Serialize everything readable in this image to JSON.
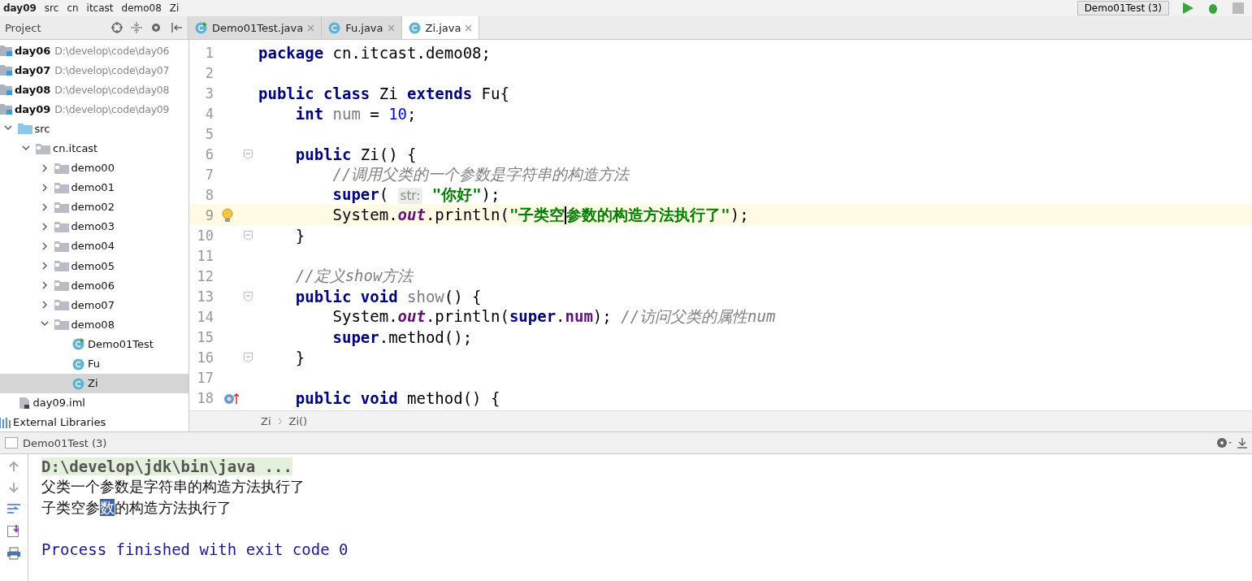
{
  "nav_bar": {
    "crumbs": [
      "day09",
      "src",
      "cn",
      "itcast",
      "demo08",
      "Zi"
    ]
  },
  "toolbar": {
    "run_config": "Demo01Test (3)"
  },
  "project_panel": {
    "title": "Project",
    "tree": [
      {
        "kind": "module",
        "label": "day06",
        "path": "D:\\develop\\code\\day06",
        "selected": false
      },
      {
        "kind": "module",
        "label": "day07",
        "path": "D:\\develop\\code\\day07",
        "selected": false
      },
      {
        "kind": "module",
        "label": "day08",
        "path": "D:\\develop\\code\\day08",
        "selected": false
      },
      {
        "kind": "module",
        "label": "day09",
        "path": "D:\\develop\\code\\day09",
        "selected": false,
        "children": [
          {
            "kind": "source",
            "label": "src",
            "expanded": true,
            "selected": false,
            "children": [
              {
                "kind": "package",
                "label": "cn.itcast",
                "expanded": true,
                "selected": false,
                "children": [
                  {
                    "kind": "package",
                    "label": "demo00",
                    "expanded": false,
                    "selected": false
                  },
                  {
                    "kind": "package",
                    "label": "demo01",
                    "expanded": false,
                    "selected": false
                  },
                  {
                    "kind": "package",
                    "label": "demo02",
                    "expanded": false,
                    "selected": false
                  },
                  {
                    "kind": "package",
                    "label": "demo03",
                    "expanded": false,
                    "selected": false
                  },
                  {
                    "kind": "package",
                    "label": "demo04",
                    "expanded": false,
                    "selected": false
                  },
                  {
                    "kind": "package",
                    "label": "demo05",
                    "expanded": false,
                    "selected": false
                  },
                  {
                    "kind": "package",
                    "label": "demo06",
                    "expanded": false,
                    "selected": false
                  },
                  {
                    "kind": "package",
                    "label": "demo07",
                    "expanded": false,
                    "selected": false
                  },
                  {
                    "kind": "package",
                    "label": "demo08",
                    "expanded": true,
                    "selected": false,
                    "children": [
                      {
                        "kind": "test",
                        "label": "Demo01Test",
                        "selected": false
                      },
                      {
                        "kind": "class",
                        "label": "Fu",
                        "selected": false
                      },
                      {
                        "kind": "class",
                        "label": "Zi",
                        "selected": true
                      }
                    ]
                  }
                ]
              }
            ]
          },
          {
            "kind": "iml",
            "label": "day09.iml",
            "selected": false
          }
        ]
      },
      {
        "kind": "libraries",
        "label": "External Libraries",
        "selected": false
      }
    ]
  },
  "tabs": [
    {
      "kind": "test",
      "label": "Demo01Test.java",
      "selected": false
    },
    {
      "kind": "class",
      "label": "Fu.java",
      "selected": false
    },
    {
      "kind": "class",
      "label": "Zi.java",
      "selected": true
    }
  ],
  "editor": {
    "lines": [
      {
        "number": "1",
        "current": false,
        "kind": "plain",
        "tokens": [
          {
            "kind": "kw",
            "text": "package"
          },
          {
            "kind": "plain",
            "text": " cn.itcast.demo08;"
          }
        ]
      },
      {
        "number": "2",
        "current": false
      },
      {
        "number": "3",
        "current": false,
        "kind": "plain",
        "tokens": [
          {
            "kind": "kw",
            "text": "public class"
          },
          {
            "kind": "plain",
            "text": " Zi "
          },
          {
            "kind": "kw",
            "text": "extends"
          },
          {
            "kind": "plain",
            "text": " Fu{"
          }
        ]
      },
      {
        "number": "4",
        "current": false,
        "kind": "plain",
        "tokens": [
          {
            "kind": "kw",
            "text": "    int"
          },
          {
            "kind": "unused",
            "text": " num"
          },
          {
            "kind": "plain",
            "text": " = "
          },
          {
            "kind": "num",
            "text": "10"
          },
          {
            "kind": "plain",
            "text": ";"
          }
        ]
      },
      {
        "number": "5",
        "current": false
      },
      {
        "number": "6",
        "current": false,
        "kind": "fold",
        "tokens": [
          {
            "kind": "kw",
            "text": "    public"
          },
          {
            "kind": "plain",
            "text": " Zi() {"
          }
        ]
      },
      {
        "number": "7",
        "current": false,
        "kind": "plain",
        "tokens": [
          {
            "kind": "comment",
            "text": "        //调用父类的一个参数是字符串的构造方法"
          }
        ]
      },
      {
        "number": "8",
        "current": false,
        "kind": "plain",
        "tokens": [
          {
            "kind": "kw",
            "text": "        super"
          },
          {
            "kind": "plain",
            "text": "( "
          },
          {
            "kind": "hint",
            "text": "str:"
          },
          {
            "kind": "str",
            "text": " \"你好\""
          },
          {
            "kind": "plain",
            "text": ");"
          }
        ]
      },
      {
        "number": "9",
        "current": true,
        "kind": "bulb",
        "tokens": [
          {
            "kind": "plain",
            "text": "        System."
          },
          {
            "kind": "field",
            "text": "out"
          },
          {
            "kind": "plain",
            "text": ".println("
          },
          {
            "kind": "str",
            "text": "\"子类空",
            "caret": true
          },
          {
            "kind": "str",
            "text": "参数的构造方法执行了\""
          },
          {
            "kind": "plain",
            "text": ");"
          }
        ]
      },
      {
        "number": "10",
        "current": false,
        "kind": "fold",
        "tokens": [
          {
            "kind": "plain",
            "text": "    }"
          }
        ]
      },
      {
        "number": "11",
        "current": false
      },
      {
        "number": "12",
        "current": false,
        "kind": "plain",
        "tokens": [
          {
            "kind": "comment",
            "text": "    //定义show方法"
          }
        ]
      },
      {
        "number": "13",
        "current": false,
        "kind": "fold",
        "tokens": [
          {
            "kind": "kw",
            "text": "    public void"
          },
          {
            "kind": "unused",
            "text": " show"
          },
          {
            "kind": "plain",
            "text": "() {"
          }
        ]
      },
      {
        "number": "14",
        "current": false,
        "kind": "plain",
        "tokens": [
          {
            "kind": "plain",
            "text": "        System."
          },
          {
            "kind": "field",
            "text": "out"
          },
          {
            "kind": "plain",
            "text": ".println("
          },
          {
            "kind": "kw",
            "text": "super"
          },
          {
            "kind": "plain",
            "text": "."
          },
          {
            "kind": "member",
            "text": "num"
          },
          {
            "kind": "plain",
            "text": "); "
          },
          {
            "kind": "comment",
            "text": "//访问父类的属性num"
          }
        ]
      },
      {
        "number": "15",
        "current": false,
        "kind": "plain",
        "tokens": [
          {
            "kind": "kw",
            "text": "        super"
          },
          {
            "kind": "plain",
            "text": ".method();"
          }
        ]
      },
      {
        "number": "16",
        "current": false,
        "kind": "fold",
        "tokens": [
          {
            "kind": "plain",
            "text": "    }"
          }
        ]
      },
      {
        "number": "17",
        "current": false
      },
      {
        "number": "18",
        "current": false,
        "kind": "override",
        "tokens": [
          {
            "kind": "kw",
            "text": "    public void"
          },
          {
            "kind": "plain",
            "text": " method() {"
          }
        ]
      }
    ],
    "breadcrumbs": [
      "Zi",
      "Zi()"
    ]
  },
  "run_panel": {
    "title": "Demo01Test (3)",
    "console": [
      {
        "kind": "command",
        "parts": [
          {
            "text": "D:\\develop\\jdk\\bin\\java ...",
            "selected": false
          }
        ]
      },
      {
        "kind": "output",
        "parts": [
          {
            "text": "父类一个参数是字符串的构造方法执行了",
            "selected": false
          }
        ]
      },
      {
        "kind": "output",
        "parts": [
          {
            "text": "子类空参",
            "selected": false
          },
          {
            "text": "数",
            "selected": true
          },
          {
            "text": "的构造方法执行了",
            "selected": false
          }
        ]
      },
      {
        "kind": "blank"
      },
      {
        "kind": "exit",
        "parts": [
          {
            "text": "Process finished with exit code 0",
            "selected": false
          }
        ]
      }
    ]
  }
}
